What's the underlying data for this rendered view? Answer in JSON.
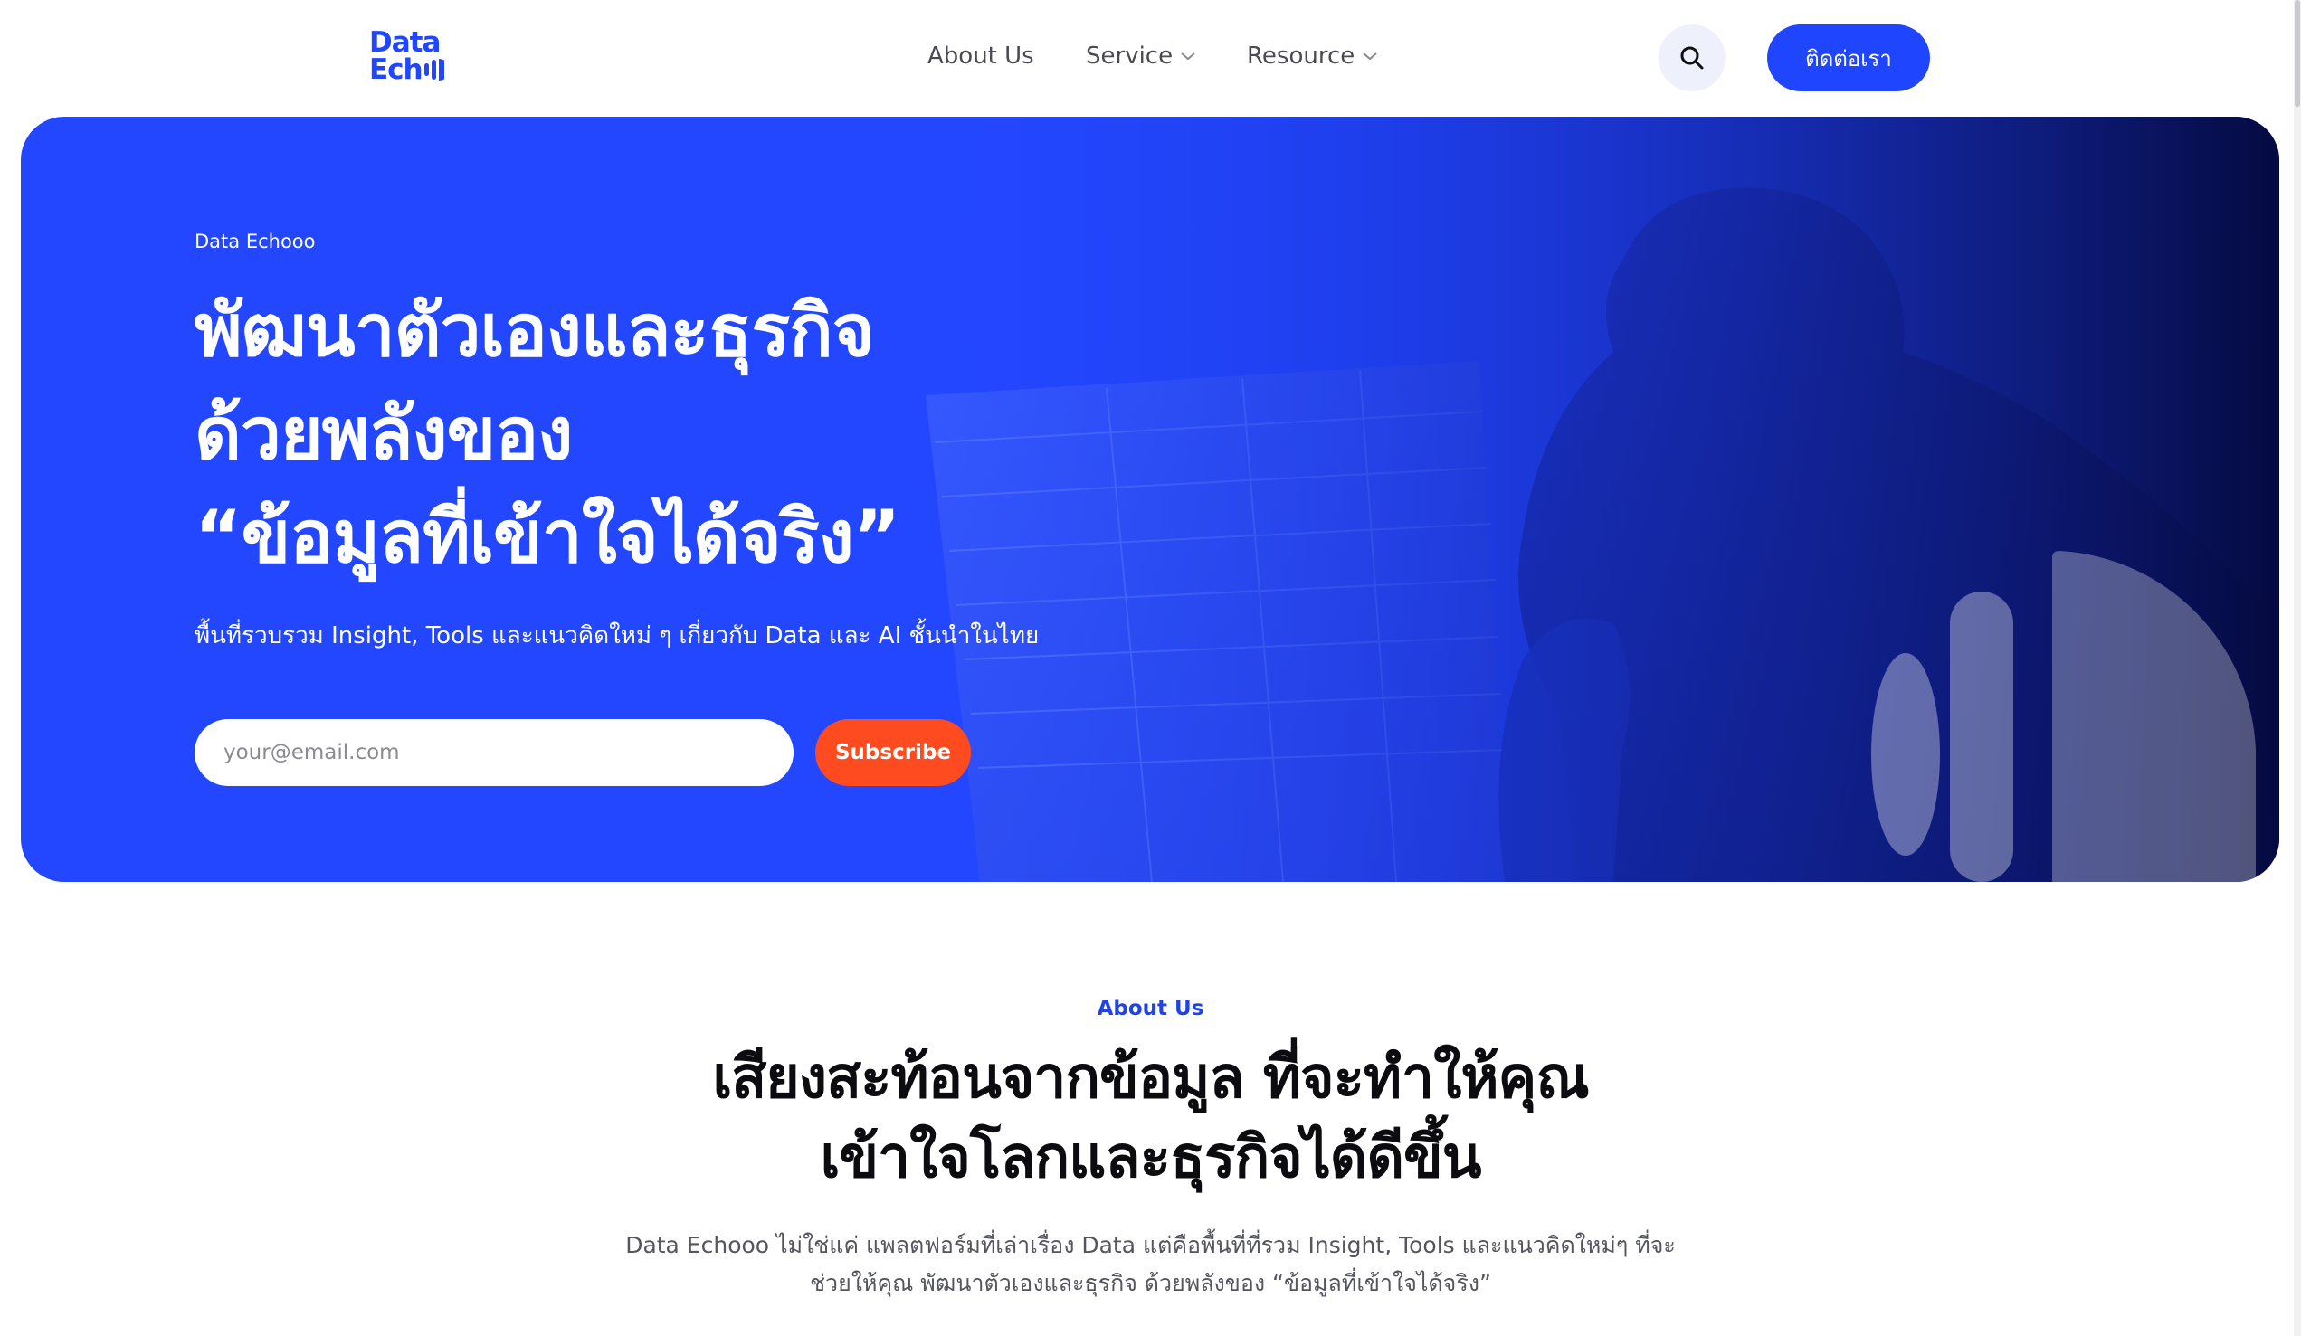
{
  "brand": {
    "logo_line1": "Data",
    "logo_line2": "Ech",
    "color": "#2146ff"
  },
  "nav": {
    "items": [
      {
        "label": "About Us"
      },
      {
        "label": "Service",
        "dropdown": true
      },
      {
        "label": "Resource",
        "dropdown": true
      }
    ],
    "search_icon": "search-icon",
    "contact_label": "ติดต่อเรา"
  },
  "hero": {
    "eyebrow": "Data Echooo",
    "title_lines": [
      "พัฒนาตัวเองและธุรกิจ",
      "ด้วยพลังของ",
      "“ข้อมูลที่เข้าใจได้จริง”"
    ],
    "subtitle": "พื้นที่รวบรวม Insight, Tools และแนวคิดใหม่ ๆ เกี่ยวกับ Data และ AI ชั้นนำในไทย",
    "email_placeholder": "your@email.com",
    "subscribe_label": "Subscribe",
    "background_color": "#2347ff",
    "button_color": "#ff4b1f"
  },
  "about": {
    "eyebrow": "About Us",
    "title_lines": [
      "เสียงสะท้อนจากข้อมูล ที่จะทำให้คุณ",
      "เข้าใจโลกและธุรกิจได้ดีขึ้น"
    ],
    "desc_lines": [
      "Data Echooo ไม่ใช่แค่ แพลตฟอร์มที่เล่าเรื่อง Data แต่คือพื้นที่ที่รวม Insight, Tools และแนวคิดใหม่ๆ ที่จะ",
      "ช่วยให้คุณ พัฒนาตัวเองและธุรกิจ ด้วยพลังของ “ข้อมูลที่เข้าใจได้จริง”"
    ]
  }
}
